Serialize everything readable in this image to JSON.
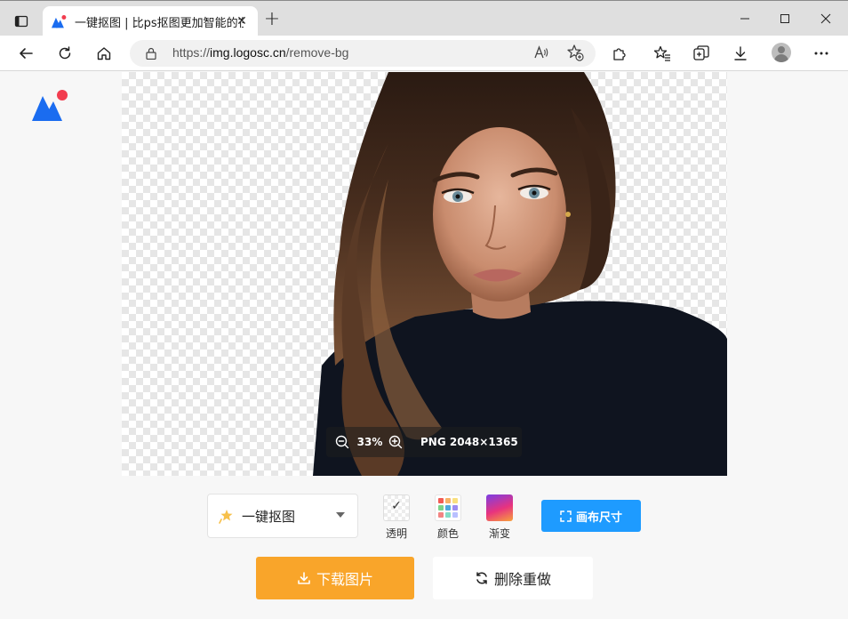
{
  "browser": {
    "tab_title": "一键抠图 | 比ps抠图更加智能的在",
    "url_prefix": "https://",
    "url_host": "img.logosc.cn",
    "url_path": "/remove-bg",
    "read_aloud": "A⁾"
  },
  "icons": {
    "tab_actions": "tab-actions-icon",
    "favicon": "logo-icon",
    "tab_close": "close-icon",
    "new_tab": "plus-icon",
    "minimize": "minimize-icon",
    "maximize": "maximize-icon",
    "close": "close-icon",
    "back": "back-arrow-icon",
    "refresh": "refresh-icon",
    "home": "home-icon",
    "lock": "lock-icon",
    "read_aloud": "read-aloud-icon",
    "add_favorite": "star-plus-icon",
    "extensions": "puzzle-icon",
    "favorites": "star-list-icon",
    "collections": "collections-icon",
    "downloads": "download-icon",
    "profile": "avatar-icon",
    "more": "ellipsis-icon"
  },
  "viewer": {
    "zoom": "33%",
    "image_info": "PNG 2048×1365"
  },
  "controls": {
    "mode_label": "一键抠图",
    "bg_options": [
      {
        "label": "透明"
      },
      {
        "label": "颜色"
      },
      {
        "label": "渐变"
      }
    ],
    "canvas_size_label": "画布尺寸",
    "download_label": "下载图片",
    "redo_label": "删除重做"
  },
  "colors": {
    "accent_blue": "#1e9bff",
    "download_orange": "#f9a52a",
    "logo_blue": "#1a6cf0",
    "logo_red": "#f23d4f"
  },
  "color_swatches": [
    "#f25c54",
    "#f7b267",
    "#f9e07f",
    "#7bd389",
    "#4ea8de",
    "#9d8df1",
    "#f28482",
    "#84dcc6",
    "#b8c0ff"
  ]
}
